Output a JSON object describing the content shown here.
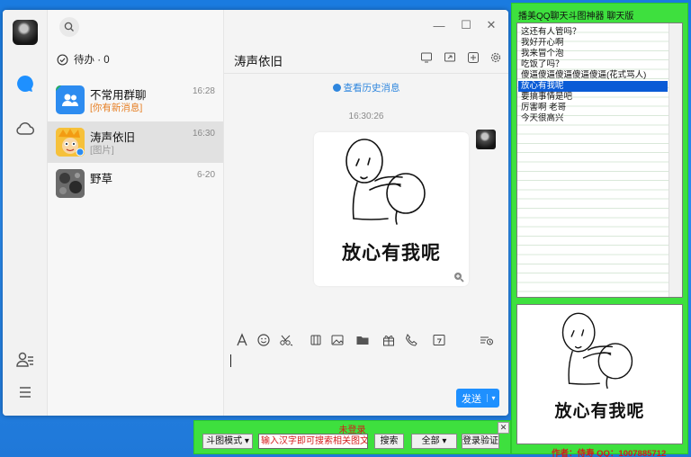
{
  "qq": {
    "todo_label": "待办 · 0",
    "contacts": [
      {
        "name": "不常用群聊",
        "time": "16:28",
        "subtitle": "[你有新消息]"
      },
      {
        "name": "涛声依旧",
        "time": "16:30",
        "subtitle": "[图片]"
      },
      {
        "name": "野草",
        "time": "6-20",
        "subtitle": ""
      }
    ],
    "chat": {
      "title": "涛声依旧",
      "history_link": "查看历史消息",
      "message_time": "16:30:26",
      "sticker_caption": "放心有我呢",
      "send_label": "发送",
      "send_dropdown": "▾"
    },
    "icons": {
      "side": [
        "chat-icon",
        "cloud-icon",
        "contacts-icon",
        "menu-icon"
      ],
      "header": [
        "screen-share-icon",
        "remote-icon",
        "add-member-icon",
        "settings-icon"
      ],
      "toolbar": [
        "font-icon",
        "emoji-icon",
        "scissors-icon",
        "media-icon",
        "image-icon",
        "folder-icon",
        "gift-icon",
        "phone-icon",
        "calendar-icon",
        "history-icon"
      ]
    },
    "colors": {
      "accent": "#1e90ff",
      "alert": "#e67e22"
    }
  },
  "tool": {
    "title": "播美QQ聊天斗图神器   聊天版",
    "phrases": [
      "这还有人管吗？",
      "我好开心啊",
      "我来冒个泡",
      "吃饭了吗？",
      "傻逼傻逼傻逼傻逼傻逼(花式骂人)",
      "放心有我呢",
      "要搞事情是吧",
      "厉害啊 老哥",
      "今天很高兴"
    ],
    "selected_phrase": "放心有我呢",
    "preview_caption": "放心有我呢",
    "author_line": "作者：侍寿    QQ：1007885712",
    "colors": {
      "panel": "#3ee03e",
      "highlight": "#0a5bd6",
      "red": "#d41b1b"
    }
  },
  "search_bar": {
    "status": "未登录",
    "mode": "斗图模式 ▾",
    "input_value": "输入汉字即可搜索相关图文",
    "search_button": "搜索",
    "scope": "全部 ▾",
    "login_button": "登录验证",
    "close": "✕"
  }
}
